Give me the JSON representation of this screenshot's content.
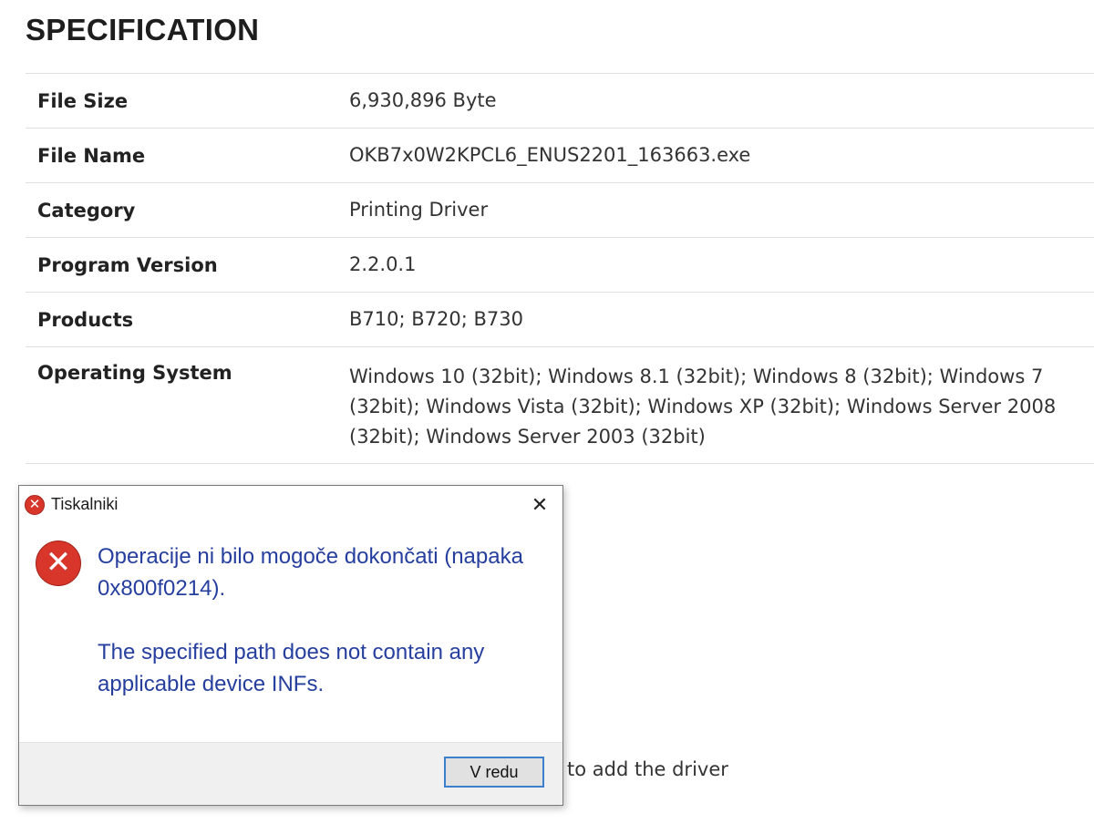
{
  "spec": {
    "title": "SPECIFICATION",
    "rows": [
      {
        "key": "File Size",
        "value": "6,930,896 Byte"
      },
      {
        "key": "File Name",
        "value": "OKB7x0W2KPCL6_ENUS2201_163663.exe"
      },
      {
        "key": "Category",
        "value": "Printing Driver"
      },
      {
        "key": "Program Version",
        "value": "2.2.0.1"
      },
      {
        "key": "Products",
        "value": "B710; B720; B730"
      },
      {
        "key": "Operating System",
        "value": "Windows 10 (32bit); Windows 8.1 (32bit); Windows 8 (32bit); Windows 7 (32bit); Windows Vista (32bit); Windows XP (32bit); Windows Server 2008 (32bit); Windows Server 2003 (32bit)"
      }
    ]
  },
  "page_tail_text": "to add the driver",
  "dialog": {
    "title": "Tiskalniki",
    "title_icon": "error-icon",
    "close_glyph": "✕",
    "error_glyph": "✕",
    "message_line1": "Operacije ni bilo mogoče dokončati (napaka 0x800f0214).",
    "message_line2": "The specified path does not contain any applicable device INFs.",
    "ok_label": "V redu"
  },
  "colors": {
    "message_text": "#263f9e",
    "error_red": "#d8362a",
    "button_focus": "#3c7fcd"
  }
}
